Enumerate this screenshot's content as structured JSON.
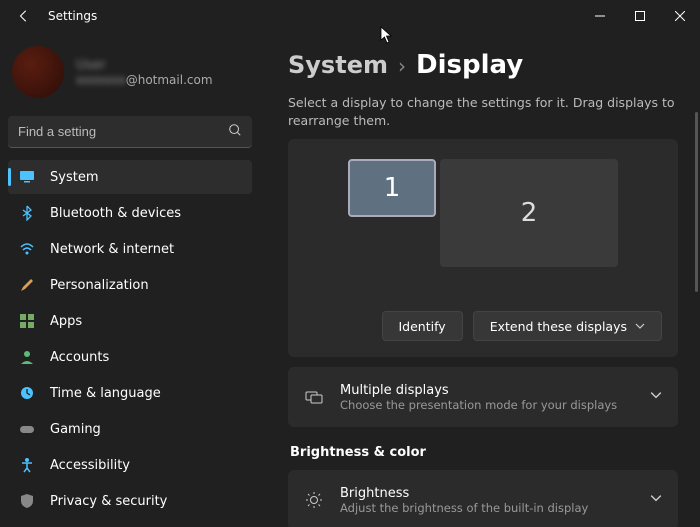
{
  "window": {
    "title": "Settings"
  },
  "profile": {
    "name": "User",
    "email_suffix": "@hotmail.com"
  },
  "search": {
    "placeholder": "Find a setting"
  },
  "nav": [
    {
      "label": "System",
      "icon": "system"
    },
    {
      "label": "Bluetooth & devices",
      "icon": "bluetooth"
    },
    {
      "label": "Network & internet",
      "icon": "wifi"
    },
    {
      "label": "Personalization",
      "icon": "brush"
    },
    {
      "label": "Apps",
      "icon": "apps"
    },
    {
      "label": "Accounts",
      "icon": "person"
    },
    {
      "label": "Time & language",
      "icon": "clock"
    },
    {
      "label": "Gaming",
      "icon": "gamepad"
    },
    {
      "label": "Accessibility",
      "icon": "accessibility"
    },
    {
      "label": "Privacy & security",
      "icon": "shield"
    }
  ],
  "breadcrumb": {
    "parent": "System",
    "current": "Display"
  },
  "hint": "Select a display to change the settings for it. Drag displays to rearrange them.",
  "monitors": {
    "m1": "1",
    "m2": "2"
  },
  "actions": {
    "identify": "Identify",
    "extend": "Extend these displays"
  },
  "multiple": {
    "title": "Multiple displays",
    "sub": "Choose the presentation mode for your displays"
  },
  "section": "Brightness & color",
  "brightness": {
    "title": "Brightness",
    "sub": "Adjust the brightness of the built-in display"
  }
}
